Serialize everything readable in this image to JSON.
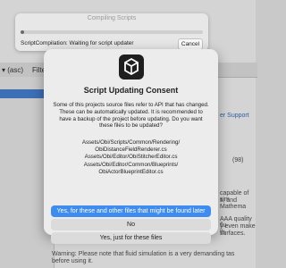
{
  "background": {
    "toolbar": [
      "▾ (asc)",
      "Filters ▾"
    ],
    "link": "er Support",
    "partial_texts": [
      "(98)",
      "capable of sim",
      "s, and Mathema",
      "AAA quality flu",
      "y even make th",
      "surfaces."
    ],
    "warning": [
      "Warning: Please note that fluid simulation is a very demanding tas",
      "before using it."
    ]
  },
  "progress_window": {
    "title": "Compiling Scripts",
    "status": "ScriptCompilation: Waiting for script updater",
    "cancel_label": "Cancel",
    "progress": 0.02
  },
  "dialog": {
    "title": "Script Updating Consent",
    "message": "Some of this projects source files refer to API that has changed. These can be automatically updated. It is recommended to have a backup of the project before updating. Do you want these files to be updated?",
    "files": [
      "Assets/Obi/Scripts/Common/Rendering/",
      "ObiDistanceFieldRenderer.cs",
      "Assets/Obi/Editor/ObiStitcherEditor.cs",
      "Assets/Obi/Editor/Common/Blueprints/",
      "ObiActorBlueprintEditor.cs"
    ],
    "buttons": {
      "primary": "Yes, for these and other files that might be found later",
      "no": "No",
      "just": "Yes, just for these files"
    }
  },
  "colors": {
    "accent": "#3f8cf1"
  }
}
